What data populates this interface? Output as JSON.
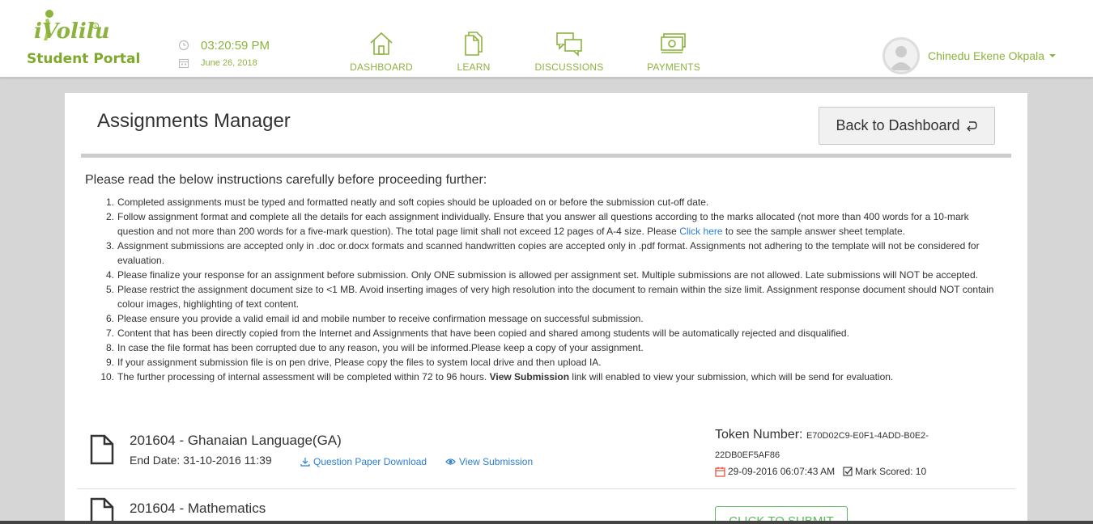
{
  "header": {
    "logo_brand": "iVolilu",
    "logo_subtitle": "Student Portal",
    "time": "03:20:59 PM",
    "date": "June 26, 2018",
    "nav": [
      {
        "label": "DASHBOARD",
        "icon": "home-icon"
      },
      {
        "label": "LEARN",
        "icon": "documents-icon"
      },
      {
        "label": "DISCUSSIONS",
        "icon": "chat-bubbles-icon"
      },
      {
        "label": "PAYMENTS",
        "icon": "money-icon"
      }
    ],
    "user_name": "Chinedu Ekene Okpala"
  },
  "page": {
    "title": "Assignments Manager",
    "back_button": "Back to Dashboard",
    "instructions_heading": "Please read the below instructions carefully before proceeding further:",
    "instructions": {
      "i1": "Completed assignments must be typed and formatted neatly and soft copies should be uploaded on or before the submission cut-off date.",
      "i2_a": "Follow assignment format and complete all the details for each assignment individually. Ensure that you answer all questions according to the marks allocated (not more than 400 words for a 10-mark question and not more than 200 words for a five-mark question). The total page limit shall not exceed 12 pages of A-4 size. Please ",
      "i2_link": "Click here",
      "i2_b": " to see the sample answer sheet template.",
      "i3": "Assignment submissions are accepted only in .doc or.docx formats and scanned handwritten copies are accepted only in .pdf format. Assignments not adhering to the template will not be considered for evaluation.",
      "i4": "Please finalize your response for an assignment before submission. Only ONE submission is allowed per assignment set. Multiple submissions are not allowed. Late submissions will NOT be accepted.",
      "i5": "Please restrict the assignment document size to <1 MB. Avoid inserting images of very high resolution into the document to remain within the size limit. Assignment response document should NOT contain colour images, highlighting of text content.",
      "i6": "Please ensure you provide a valid email id and mobile number to receive confirmation message on successful submission.",
      "i7": "Content that has been directly copied from the Internet and Assignments that have been copied and shared among students will be automatically rejected and disqualified.",
      "i8": "In case the file format has been corrupted due to any reason, you will be informed.Please keep a copy of your assignment.",
      "i9": "If your assignment submission file is on pen drive, Please copy the files to system local drive and then upload IA.",
      "i10_a": "The further processing of internal assessment will be completed within 72 to 96 hours. ",
      "i10_bold": "View Submission",
      "i10_b": " link will enabled to view your submission, which will be send for evaluation."
    }
  },
  "assignments": [
    {
      "title": "201604 - Ghanaian Language(GA)",
      "end_date": "End Date: 31-10-2016 11:39",
      "download_label": "Question Paper Download",
      "view_label": "View Submission",
      "token_label": "Token Number:",
      "token_value_1": "E70D02C9-E0F1-4ADD-B0E2-",
      "token_value_2": "22DB0EF5AF86",
      "submitted_at": "29-09-2016 06:07:43 AM",
      "mark": "Mark Scored: 10"
    },
    {
      "title": "201604 - Mathematics",
      "submit_label": "CLICK TO SUBMIT"
    }
  ],
  "colors": {
    "accent_green": "#8cb33e",
    "link_blue": "#2a7fd4",
    "submit_green": "#5cb85c",
    "calendar_red": "#e04b3a"
  },
  "numbers": [
    "1.",
    "2.",
    "3.",
    "4.",
    "5.",
    "6.",
    "7.",
    "8.",
    "9.",
    "10."
  ]
}
